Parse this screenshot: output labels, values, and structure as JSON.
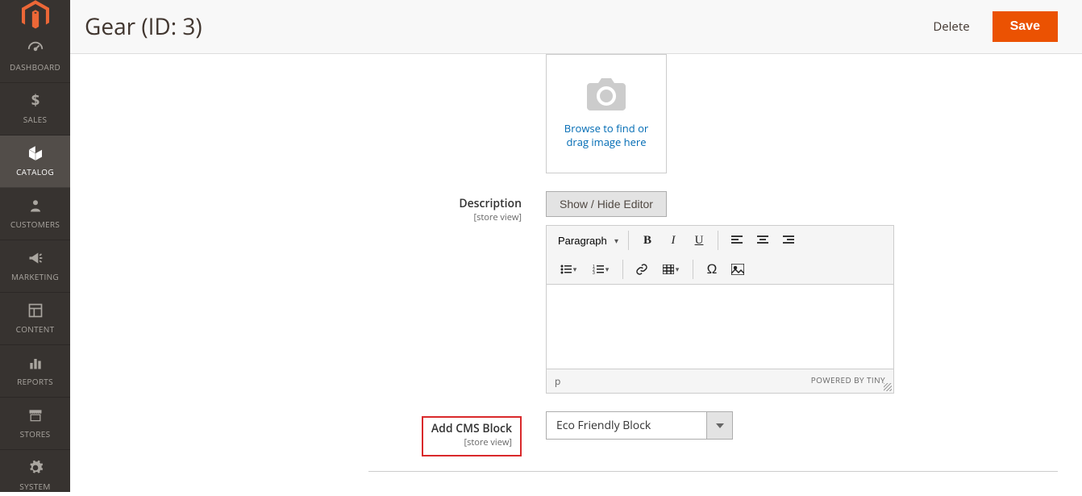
{
  "header": {
    "title": "Gear (ID: 3)",
    "delete_label": "Delete",
    "save_label": "Save"
  },
  "sidebar": {
    "items": [
      {
        "label": "Dashboard",
        "icon": "gauge"
      },
      {
        "label": "Sales",
        "icon": "dollar"
      },
      {
        "label": "Catalog",
        "icon": "cube",
        "active": true
      },
      {
        "label": "Customers",
        "icon": "person"
      },
      {
        "label": "Marketing",
        "icon": "megaphone"
      },
      {
        "label": "Content",
        "icon": "layout"
      },
      {
        "label": "Reports",
        "icon": "bars"
      },
      {
        "label": "Stores",
        "icon": "storefront"
      },
      {
        "label": "System",
        "icon": "gear"
      }
    ]
  },
  "image_upload": {
    "browse_text": "Browse to find or drag image here"
  },
  "fields": {
    "description": {
      "label": "Description",
      "scope": "[store view]"
    },
    "cms_block": {
      "label": "Add CMS Block",
      "scope": "[store view]"
    }
  },
  "editor": {
    "toggle_label": "Show / Hide Editor",
    "format_value": "Paragraph",
    "status_path": "p",
    "powered_by": "POWERED BY TINY"
  },
  "cms_block_select": {
    "value": "Eco Friendly Block"
  }
}
